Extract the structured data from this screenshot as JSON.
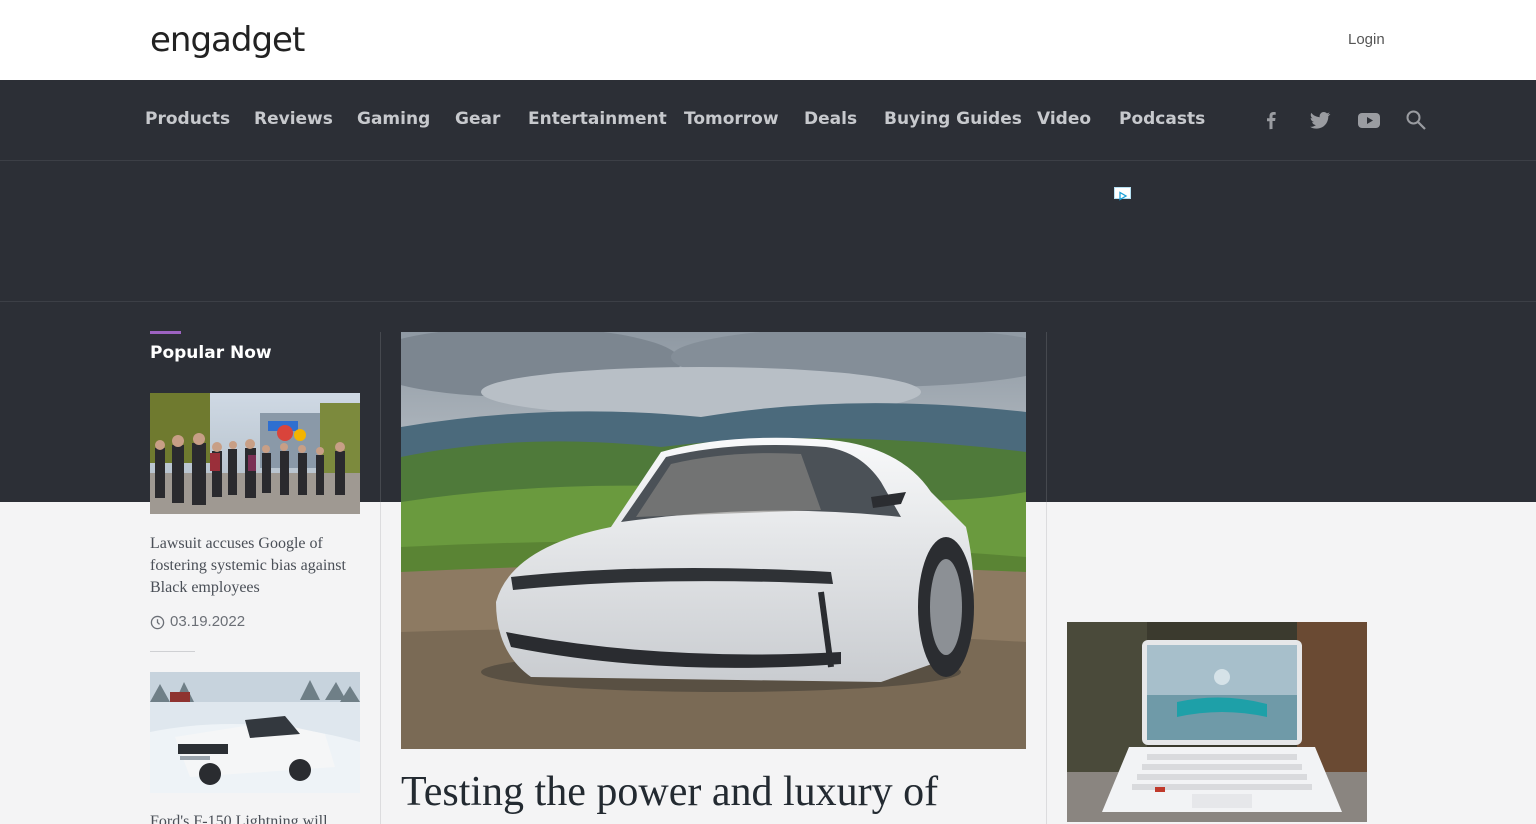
{
  "header": {
    "logo_text": "engadget",
    "login_label": "Login"
  },
  "nav": {
    "items": [
      "Products",
      "Reviews",
      "Gaming",
      "Gear",
      "Entertainment",
      "Tomorrow",
      "Deals",
      "Buying Guides",
      "Video",
      "Podcasts"
    ],
    "social_icons": [
      "facebook-icon",
      "twitter-icon",
      "youtube-icon",
      "search-icon"
    ]
  },
  "popular": {
    "title": "Popular Now",
    "stories": [
      {
        "title": "Lawsuit accuses Google of fostering systemic bias against Black employees",
        "date": "03.19.2022"
      },
      {
        "title": "Ford's F-150 Lightning will"
      }
    ]
  },
  "hero": {
    "title": "Testing the power and luxury of"
  },
  "colors": {
    "dark_band": "#2c2f36",
    "accent": "#9d63c2",
    "nav_text": "#c7c9cd"
  }
}
